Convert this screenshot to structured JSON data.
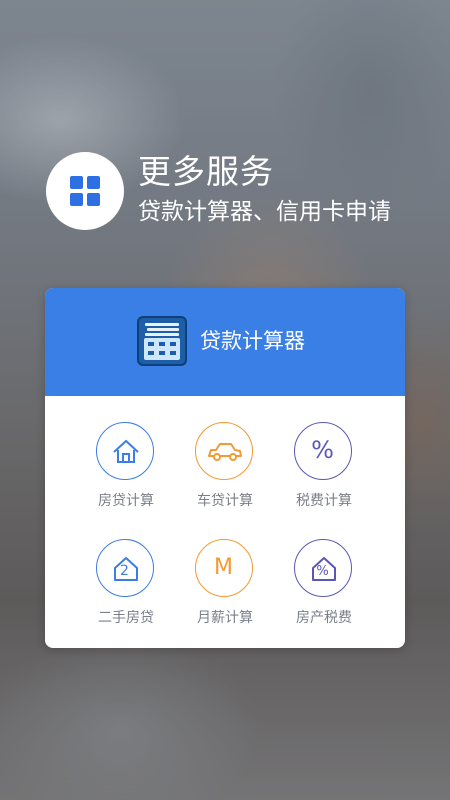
{
  "header": {
    "title": "更多服务",
    "subtitle": "贷款计算器、信用卡申请",
    "icon": "grid-icon"
  },
  "card": {
    "title": "贷款计算器",
    "icon": "calculator-icon",
    "accent_color": "#3a7fe6",
    "items": [
      {
        "label": "房贷计算",
        "icon": "house-icon",
        "color": "#3c7ee3"
      },
      {
        "label": "车贷计算",
        "icon": "car-icon",
        "color": "#f29a33"
      },
      {
        "label": "税费计算",
        "icon": "percent-icon",
        "glyph": "%",
        "color": "#5a58b6"
      },
      {
        "label": "二手房贷",
        "icon": "house-2-icon",
        "glyph": "2",
        "color": "#3c7ee3"
      },
      {
        "label": "月薪计算",
        "icon": "salary-m-icon",
        "glyph": "M",
        "color": "#f29a33"
      },
      {
        "label": "房产税费",
        "icon": "house-percent-icon",
        "glyph": "%",
        "color": "#5a58b6"
      }
    ]
  }
}
